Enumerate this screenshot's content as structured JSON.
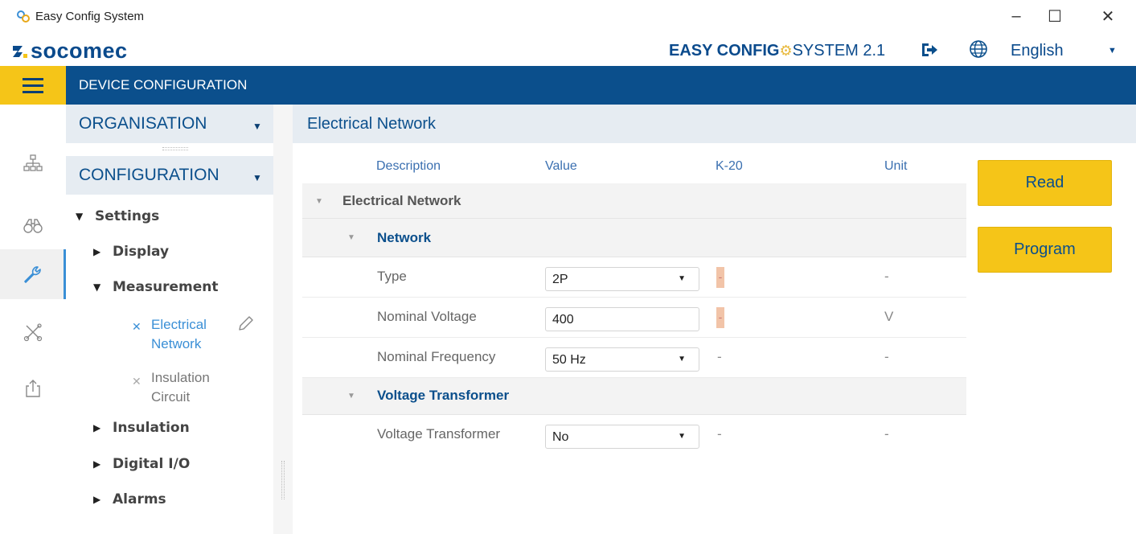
{
  "window": {
    "title": "Easy Config System",
    "controls": {
      "minimize": "–",
      "maximize": "☐",
      "close": "✕"
    }
  },
  "brand": {
    "logo_text": "socomec",
    "product_bold": "EASY CONFIG",
    "product_light": "SYSTEM 2.1",
    "language": "English"
  },
  "navbar": {
    "title": "DEVICE CONFIGURATION"
  },
  "rail": {
    "items": [
      {
        "icon": "network-topology-icon",
        "active": false
      },
      {
        "icon": "binoculars-icon",
        "active": false
      },
      {
        "icon": "wrench-icon",
        "active": true
      },
      {
        "icon": "tools-icon",
        "active": false
      },
      {
        "icon": "export-icon",
        "active": false
      }
    ]
  },
  "tree": {
    "organisation_label": "ORGANISATION",
    "configuration_label": "CONFIGURATION",
    "settings": "Settings",
    "display": "Display",
    "measurement": "Measurement",
    "electrical_line1": "Electrical",
    "electrical_line2": "Network",
    "insulation_line1": "Insulation",
    "insulation_line2": "Circuit",
    "insulation": "Insulation",
    "digital_io": "Digital I/O",
    "alarms": "Alarms"
  },
  "main": {
    "page_title": "Electrical Network",
    "columns": {
      "description": "Description",
      "value": "Value",
      "k20": "K-20",
      "unit": "Unit"
    },
    "groups": {
      "electrical_network": "Electrical Network",
      "network": "Network",
      "voltage_transformer": "Voltage Transformer"
    },
    "rows": {
      "type": {
        "label": "Type",
        "value": "2P",
        "k20": "-",
        "unit": "-"
      },
      "nominal_voltage": {
        "label": "Nominal Voltage",
        "value": "400",
        "k20": "-",
        "unit": "V"
      },
      "nominal_frequency": {
        "label": "Nominal Frequency",
        "value": "50 Hz",
        "k20": "-",
        "unit": "-"
      },
      "voltage_transformer": {
        "label": "Voltage Transformer",
        "value": "No",
        "k20": "-",
        "unit": "-"
      }
    },
    "buttons": {
      "read": "Read",
      "program": "Program"
    }
  },
  "colors": {
    "brand_blue": "#0b4f8c",
    "accent_yellow": "#f5c518",
    "link_blue": "#3a8fd6",
    "modified_marker": "#f2c4a8"
  }
}
